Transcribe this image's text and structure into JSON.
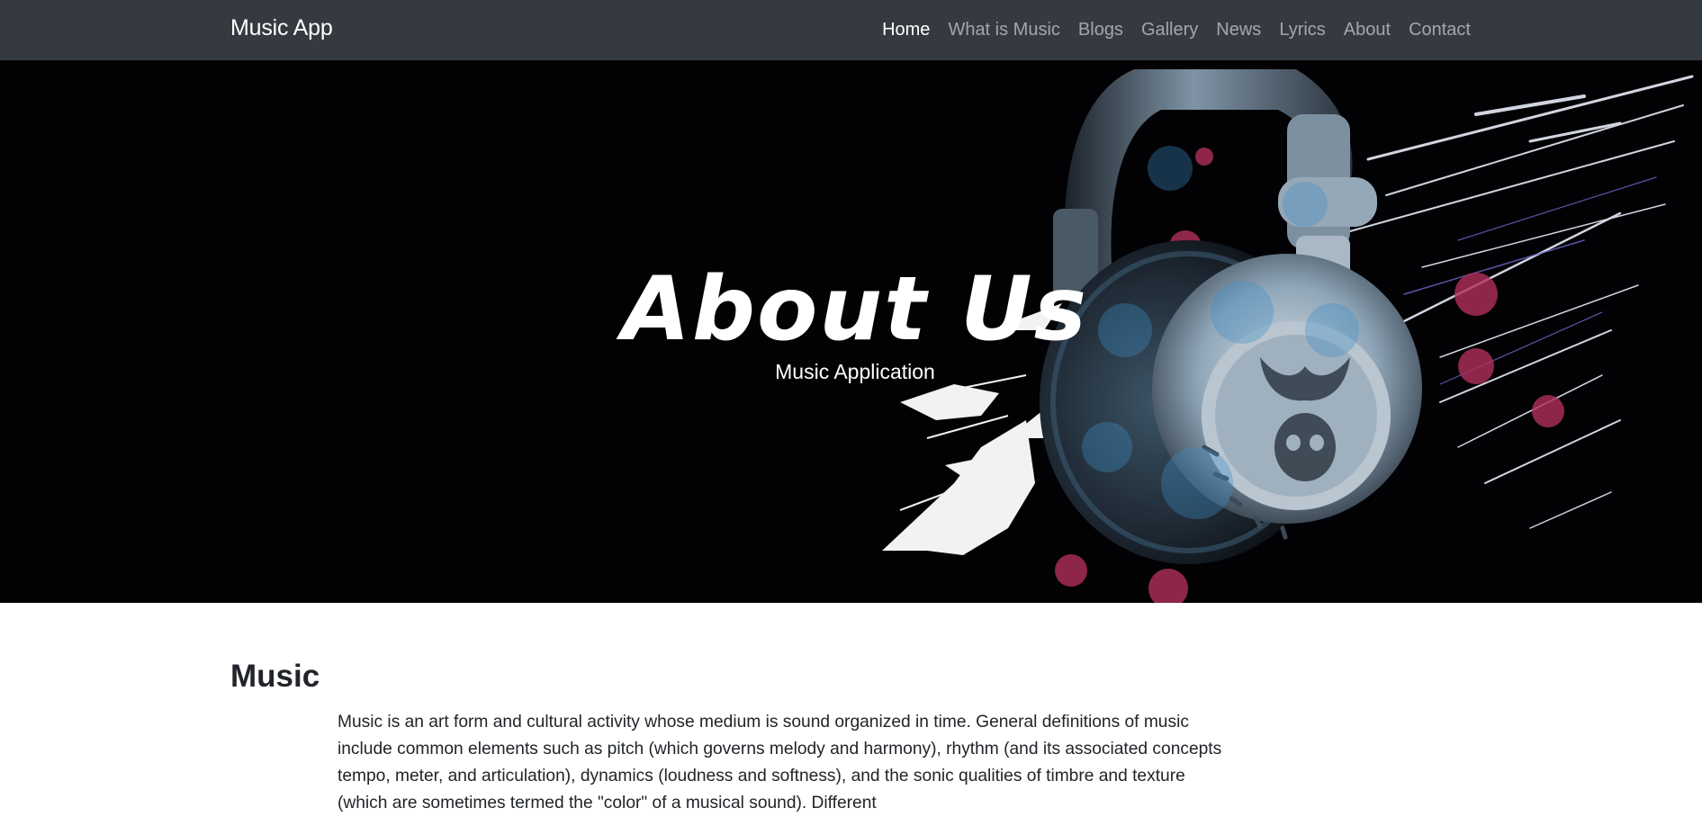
{
  "navbar": {
    "brand": "Music App",
    "links": [
      {
        "label": "Home",
        "active": true
      },
      {
        "label": "What is Music",
        "active": false
      },
      {
        "label": "Blogs",
        "active": false
      },
      {
        "label": "Gallery",
        "active": false
      },
      {
        "label": "News",
        "active": false
      },
      {
        "label": "Lyrics",
        "active": false
      },
      {
        "label": "About",
        "active": false
      },
      {
        "label": "Contact",
        "active": false
      }
    ]
  },
  "hero": {
    "title": "About Us",
    "subtitle": "Music Application",
    "image": "headphones-splash-image"
  },
  "section": {
    "heading": "Music",
    "paragraph": "Music is an art form and cultural activity whose medium is sound organized in time. General definitions of music include common elements such as pitch (which governs melody and harmony), rhythm (and its associated concepts tempo, meter, and articulation), dynamics (loudness and softness), and the sonic qualities of timbre and texture (which are sometimes termed the \"color\" of a musical sound). Different"
  },
  "colors": {
    "navbar_bg": "#343a40",
    "hero_bg": "#020205",
    "accent_blue": "#3f8fc9",
    "text": "#212529"
  }
}
